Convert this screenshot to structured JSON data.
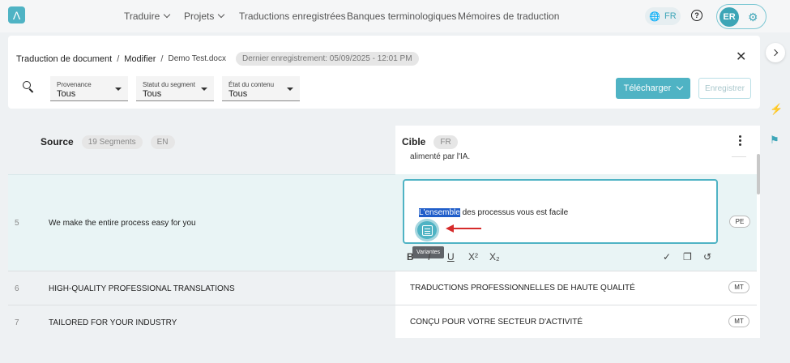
{
  "nav": {
    "logo": "Λ",
    "items": [
      {
        "label": "Traduire",
        "has_chevron": true
      },
      {
        "label": "Projets",
        "has_chevron": true
      },
      {
        "label": "Traductions enregistrées",
        "has_chevron": false
      },
      {
        "label": "Banques terminologiques",
        "has_chevron": false
      },
      {
        "label": "Mémoires de traduction",
        "has_chevron": false
      }
    ],
    "language": "FR",
    "help": "?",
    "user_initials": "ER"
  },
  "header": {
    "breadcrumb": [
      "Traduction de document",
      "Modifier",
      "Demo Test.docx"
    ],
    "save_status": "Dernier enregistrement: 05/09/2025 - 12:01 PM",
    "close_icon": "✕"
  },
  "filters": [
    {
      "label": "Provenance",
      "value": "Tous"
    },
    {
      "label": "Statut du segment",
      "value": "Tous"
    },
    {
      "label": "État du contenu",
      "value": "Tous"
    }
  ],
  "actions": {
    "download": "Télécharger",
    "save": "Enregistrer"
  },
  "columns": {
    "source": {
      "title": "Source",
      "segments": "19 Segments",
      "lang": "EN"
    },
    "target": {
      "title": "Cible",
      "lang": "FR"
    }
  },
  "previous_target_fragment": "alimenté par l'IA.",
  "rows": [
    {
      "num": "5",
      "source": "We make the entire process easy for you",
      "target_highlight": "L'ensemble",
      "target_rest": " des processus vous est facile",
      "badge": "PE"
    },
    {
      "num": "6",
      "source": "HIGH-QUALITY PROFESSIONAL TRANSLATIONS",
      "target": "TRADUCTIONS PROFESSIONNELLES DE HAUTE QUALITÉ",
      "badge": "MT"
    },
    {
      "num": "7",
      "source": "TAILORED FOR YOUR INDUSTRY",
      "target": "CONÇU POUR VOTRE SECTEUR D'ACTIVITÉ",
      "badge": "MT"
    }
  ],
  "tooltip": "Variantes",
  "format_toolbar": {
    "bold": "B",
    "italic": "I",
    "underline": "U",
    "superscript": "X²",
    "subscript": "X₂",
    "confirm": "✓",
    "copy": "❐",
    "history": "↺"
  },
  "colors": {
    "accent": "#4fb3c4",
    "highlight": "#1f5dc9",
    "arrow": "#d62b2b",
    "row_active": "#e9f4f5"
  }
}
